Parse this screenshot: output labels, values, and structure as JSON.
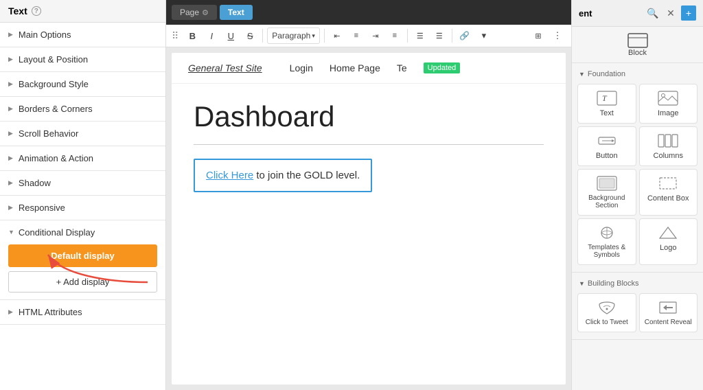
{
  "leftPanel": {
    "title": "Text",
    "help": "?",
    "sections": [
      {
        "id": "main-options",
        "label": "Main Options",
        "expanded": false
      },
      {
        "id": "layout-position",
        "label": "Layout & Position",
        "expanded": false
      },
      {
        "id": "background-style",
        "label": "Background Style",
        "expanded": false
      },
      {
        "id": "borders-corners",
        "label": "Borders & Corners",
        "expanded": false
      },
      {
        "id": "scroll-behavior",
        "label": "Scroll Behavior",
        "expanded": false
      },
      {
        "id": "animation-action",
        "label": "Animation & Action",
        "expanded": false
      },
      {
        "id": "shadow",
        "label": "Shadow",
        "expanded": false
      },
      {
        "id": "responsive",
        "label": "Responsive",
        "expanded": false
      }
    ],
    "conditionalDisplay": {
      "label": "Conditional Display",
      "defaultDisplayLabel": "Default display",
      "addDisplayLabel": "+ Add display"
    },
    "htmlAttributes": {
      "label": "HTML Attributes"
    }
  },
  "topBar": {
    "pageTabLabel": "Page",
    "textTabLabel": "Text",
    "gearIcon": "⚙"
  },
  "formattingBar": {
    "dragHandle": "⠿",
    "boldLabel": "B",
    "italicLabel": "I",
    "underlineLabel": "U",
    "strikeLabel": "S",
    "paragraphDropdown": "Paragraph",
    "alignLeft": "≡",
    "alignCenter": "≡",
    "alignRight": "≡",
    "justify": "≡",
    "listUnordered": "≡",
    "listOrdered": "≡",
    "linkIcon": "🔗",
    "moreIcon": "⋮"
  },
  "canvas": {
    "siteName": "General Test Site",
    "navItems": [
      "Login",
      "Home Page",
      "Te"
    ],
    "updatedBadge": "Updated",
    "pageTitle": "Dashboard",
    "ctaText": "to join the GOLD level.",
    "ctaLinkText": "Click Here"
  },
  "rightPanel": {
    "title": "ent",
    "searchIcon": "🔍",
    "closeIcon": "✕",
    "addIcon": "+",
    "foundation": {
      "label": "Foundation",
      "elements": [
        {
          "id": "text",
          "label": "Text"
        },
        {
          "id": "image",
          "label": "Image"
        },
        {
          "id": "button",
          "label": "Button"
        },
        {
          "id": "columns",
          "label": "Columns"
        },
        {
          "id": "background-section",
          "label": "Background Section"
        },
        {
          "id": "content-box",
          "label": "Content Box"
        },
        {
          "id": "templates-symbols",
          "label": "Templates & Symbols"
        },
        {
          "id": "logo",
          "label": "Logo"
        }
      ]
    },
    "buildingBlocks": {
      "label": "Building Blocks",
      "elements": [
        {
          "id": "click-to-tweet",
          "label": "Click to Tweet"
        },
        {
          "id": "content-reveal",
          "label": "Content Reveal"
        }
      ]
    }
  },
  "colors": {
    "orange": "#f7941d",
    "blue": "#3498db",
    "green": "#2ecc71",
    "red": "#e74c3c",
    "darkBg": "#2d2d2d",
    "activeTab": "#4a9fd4"
  }
}
